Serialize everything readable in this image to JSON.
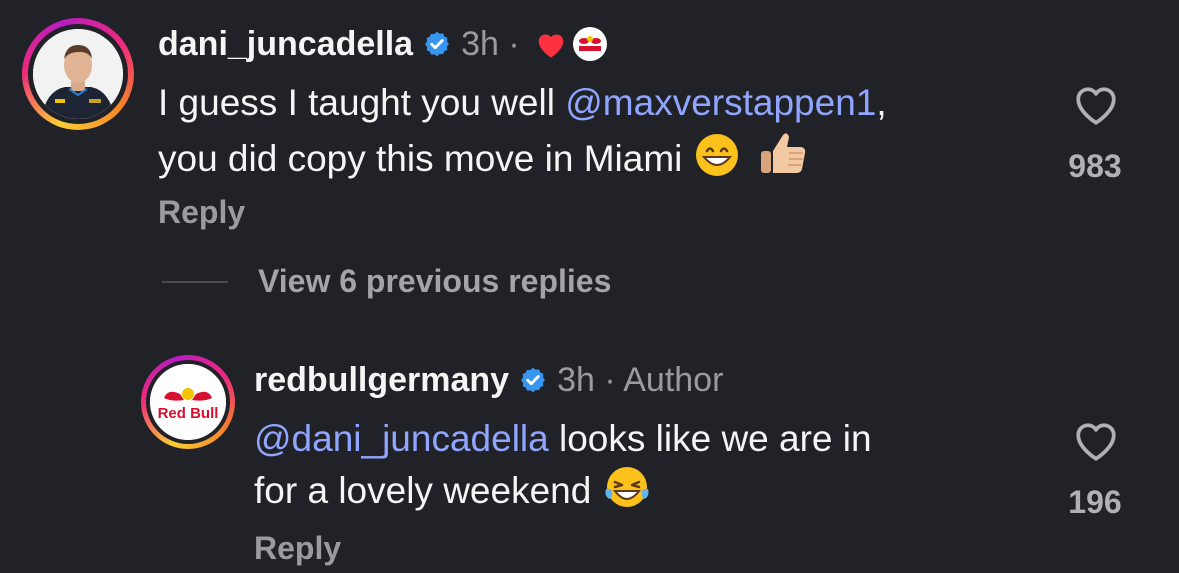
{
  "comments": [
    {
      "username": "dani_juncadella",
      "time": "3h ·",
      "text_1": "I guess I taught you well ",
      "mention": "@maxverstappen1",
      "text_1_end": ",",
      "text_2": "you did copy this move in Miami ",
      "reply_label": "Reply",
      "likes": "983",
      "icons": [
        "verified-badge-icon",
        "heart-icon",
        "redbull-badge-icon",
        "grinning-emoji-icon",
        "thumbs-up-emoji-icon",
        "like-heart-icon"
      ]
    },
    {
      "username": "redbullgermany",
      "time": "3h · Author",
      "mention": "@dani_juncadella",
      "text_1": " looks like we are in",
      "text_2": "for a lovely weekend ",
      "reply_label": "Reply",
      "likes": "196",
      "icons": [
        "verified-badge-icon",
        "laughing-emoji-icon",
        "like-heart-icon"
      ]
    }
  ],
  "view_replies": "View 6 previous replies",
  "avatar_logo_text": "Red Bull",
  "colors": {
    "background": "#212227",
    "mention": "#8fa5ff",
    "verified": "#3797f0",
    "heart": "#ff3040",
    "secondary_text": "#9a9ba1"
  }
}
